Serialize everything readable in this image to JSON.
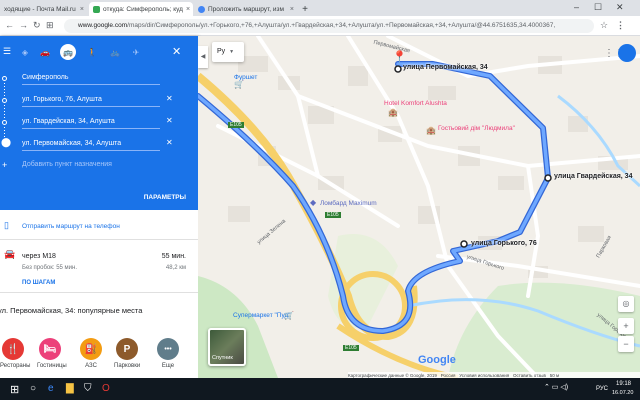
{
  "browser": {
    "tabs": [
      {
        "label": "ходящие - Почта Mail.ru",
        "color": "#f0a030"
      },
      {
        "label": "откуда: Симферополь; куд",
        "color": "#34a853"
      },
      {
        "label": "Проложить маршрут, изм",
        "color": "#4285f4"
      }
    ],
    "new_tab": "+",
    "url_host": "www.google.com",
    "url_path": "/maps/dir/Симферополь/ул.+Горького,+76,+Алушта/ул.+Гвардейская,+34,+Алушта/ул.+Первомайская,+34,+Алушта/@44.6751635,34.4000367,"
  },
  "directions": {
    "waypoints": [
      "Симферополь",
      "ул. Горького, 76, Алушта",
      "ул. Гвардейская, 34, Алушта",
      "ул. Первомайская, 34, Алушта"
    ],
    "add_destination": "Добавить пункт назначения",
    "params_label": "ПАРАМЕТРЫ",
    "send_to_phone": "Отправить маршрут на телефон",
    "route": {
      "via": "через М18",
      "duration": "55 мин.",
      "traffic_note": "Без пробок: 55 мин.",
      "distance": "48,2 км",
      "steps_link": "ПО ШАГАМ"
    },
    "popular_title": "ул. Первомайская, 34: популярные места",
    "categories": [
      {
        "label": "Рестораны",
        "icon": "fork-knife-icon",
        "color": "#e53935",
        "glyph": "🍴"
      },
      {
        "label": "Гостиницы",
        "icon": "bed-icon",
        "color": "#ec407a",
        "glyph": "🛏"
      },
      {
        "label": "АЗС",
        "icon": "gas-station-icon",
        "color": "#f39c12",
        "glyph": "⛽"
      },
      {
        "label": "Парковки",
        "icon": "parking-icon",
        "color": "#8d5a2b",
        "glyph": "P"
      },
      {
        "label": "Еще",
        "icon": "more-icon",
        "color": "#607d8b",
        "glyph": "•••"
      }
    ]
  },
  "map": {
    "language": "Ру",
    "pins": [
      {
        "label": "улица Первомайская, 34"
      },
      {
        "label": "улица Гвардейская, 34"
      },
      {
        "label": "улица Горького, 76"
      }
    ],
    "places": [
      {
        "label": "Фуршет",
        "color": "#1a73e8"
      },
      {
        "label": "Hotel Komfort Alushta",
        "color": "#ec407a"
      },
      {
        "label": "Гостьовий дім \"Людмила\"",
        "color": "#ec407a"
      },
      {
        "label": "Ломбард Maximum",
        "color": "#5c6bc0"
      },
      {
        "label": "Супермаркет \"Пуд\"",
        "color": "#1a73e8"
      }
    ],
    "streets": [
      "Первомайская",
      "улица Горького",
      "улица Горького",
      "улица Зелена",
      "Парковая"
    ],
    "road_badges": [
      "Е105",
      "Е105",
      "Е105"
    ],
    "satellite_label": "Спутник",
    "logo": "Google",
    "footer": [
      "Картографические данные © Google, 2019",
      "Россия",
      "Условия использования",
      "Оставить отзыв",
      "50 м"
    ]
  },
  "taskbar": {
    "lang": "РУС",
    "time": "19:18",
    "date": "16.07.20"
  },
  "colors": {
    "route": "#4c8bf5",
    "accent": "#1a73e8"
  }
}
